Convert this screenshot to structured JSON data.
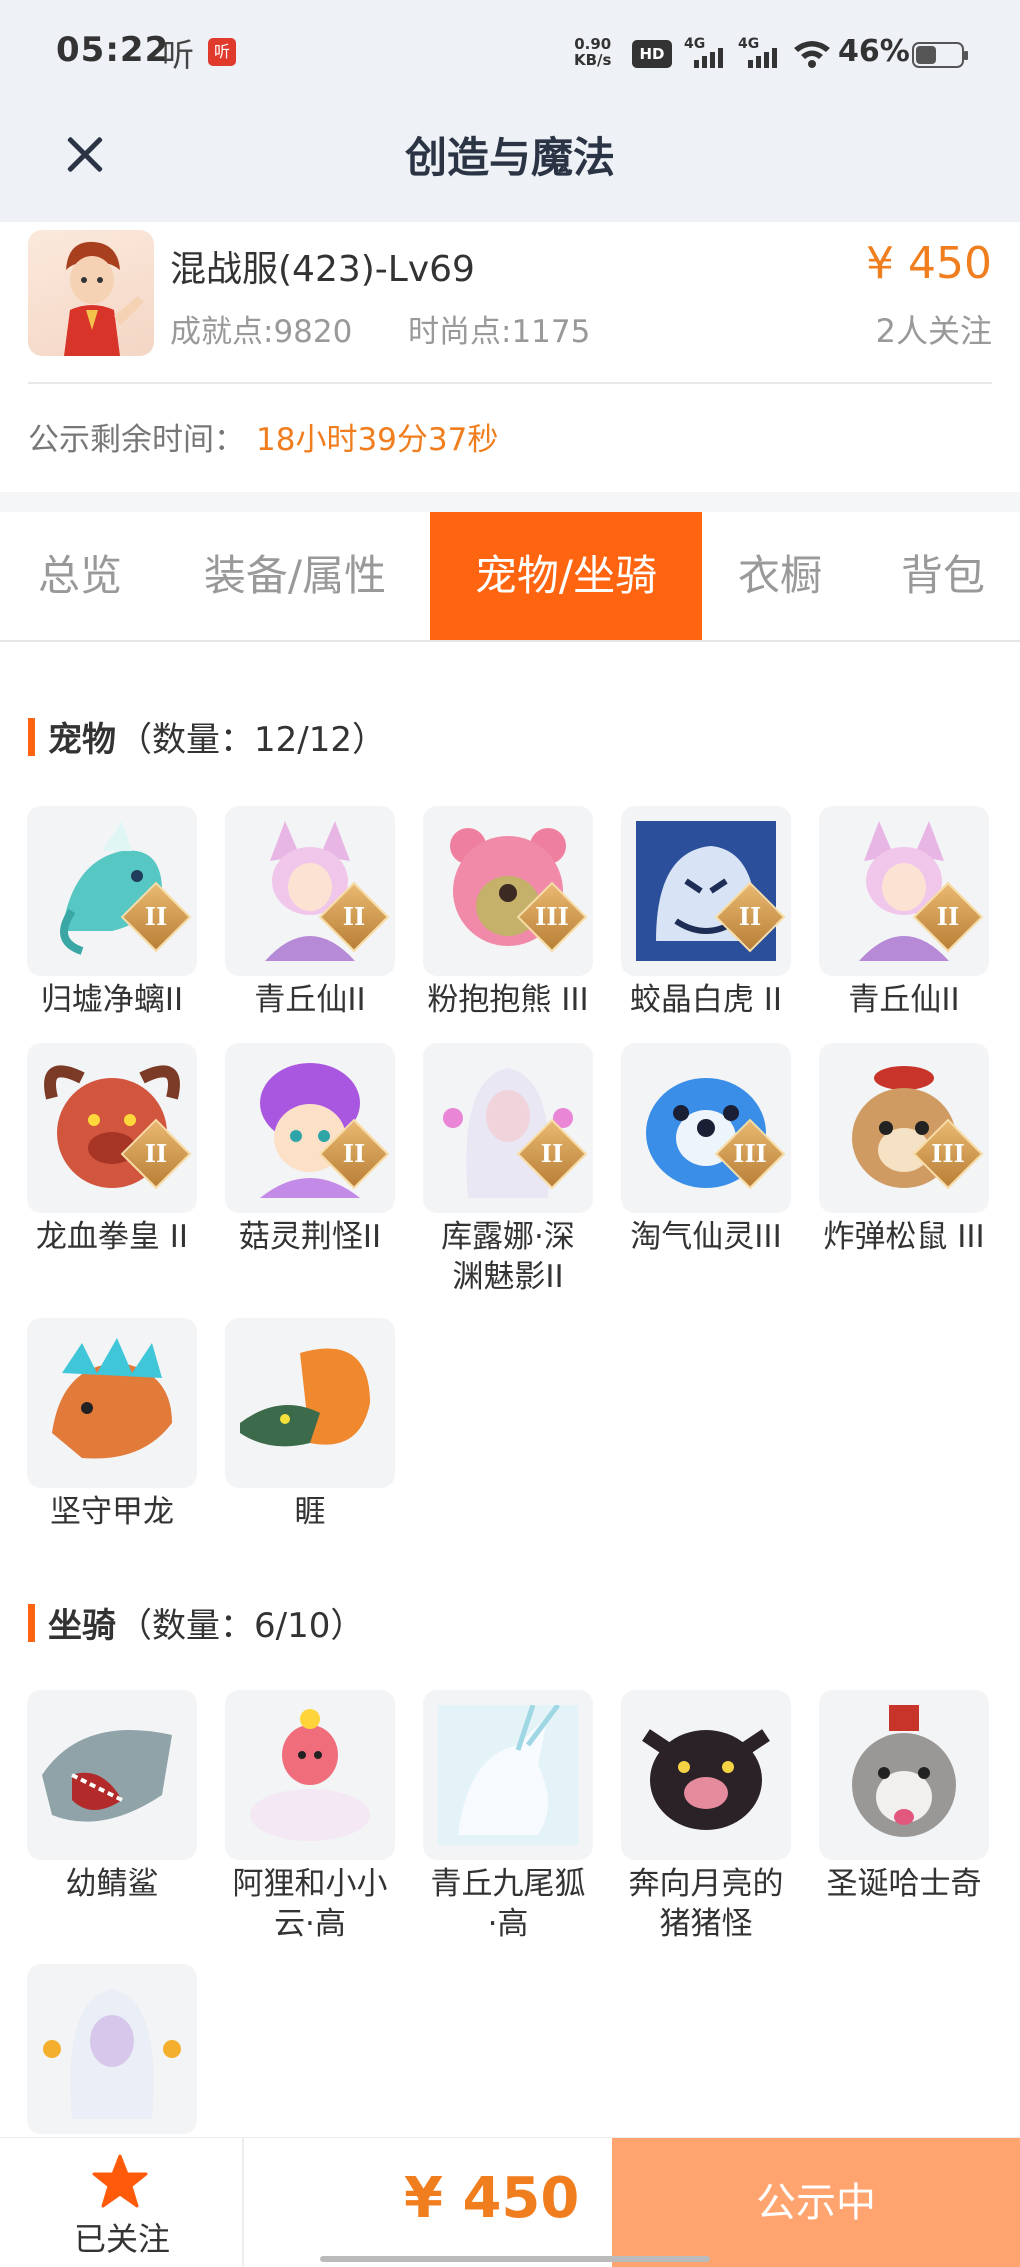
{
  "status_bar": {
    "time": "05:22",
    "listen_text": "听",
    "app_badge": "听",
    "net_speed_value": "0.90",
    "net_speed_unit": "KB/s",
    "hd_label": "HD",
    "signal_1": "4G",
    "signal_2": "4G",
    "battery_percent": "46%",
    "battery_level": 0.46
  },
  "header": {
    "title": "创造与魔法",
    "close_icon": "close-icon"
  },
  "character": {
    "name": "混战服(423)-Lv69",
    "price": "¥ 450",
    "achievement": "成就点:9820",
    "fashion": "时尚点:1175",
    "followers": "2人关注",
    "notice_label": "公示剩余时间：",
    "notice_time": "18小时39分37秒"
  },
  "tabs": [
    {
      "label": "总览",
      "active": false
    },
    {
      "label": "装备/属性",
      "active": false
    },
    {
      "label": "宠物/坐骑",
      "active": true
    },
    {
      "label": "衣橱",
      "active": false
    },
    {
      "label": "背包",
      "active": false
    }
  ],
  "pets": {
    "title": "宠物",
    "count": "（数量：12/12）",
    "items": [
      {
        "label": "归墟净螭II",
        "rank": "II"
      },
      {
        "label": "青丘仙II",
        "rank": "II"
      },
      {
        "label": "粉抱抱熊 III",
        "rank": "III"
      },
      {
        "label": "蛟晶白虎 II",
        "rank": "II"
      },
      {
        "label": "青丘仙II",
        "rank": "II"
      },
      {
        "label": "龙血拳皇 II",
        "rank": "II"
      },
      {
        "label": "菇灵荆怪II",
        "rank": "II"
      },
      {
        "label_line1": "库露娜·深",
        "label_line2": "渊魅影II",
        "rank": "II"
      },
      {
        "label": "淘气仙灵III",
        "rank": "III"
      },
      {
        "label": "炸弹松鼠 III",
        "rank": "III"
      },
      {
        "label": "坚守甲龙",
        "rank": ""
      },
      {
        "label": "睚",
        "rank": ""
      }
    ]
  },
  "mounts": {
    "title": "坐骑",
    "count": "（数量：6/10）",
    "items": [
      {
        "label": "幼鲭鲨"
      },
      {
        "label_line1": "阿狸和小小",
        "label_line2": "云·高"
      },
      {
        "label_line1": "青丘九尾狐",
        "label_line2": "·高"
      },
      {
        "label_line1": "奔向月亮的",
        "label_line2": "猪猪怪"
      },
      {
        "label": "圣诞哈士奇"
      },
      {
        "label": ""
      }
    ]
  },
  "bottom": {
    "follow_label": "已关注",
    "price": "¥ 450",
    "status_button": "公示中"
  },
  "colors": {
    "accent": "#ff6510",
    "price": "#f07d1e",
    "status_button": "#ffa46e"
  }
}
